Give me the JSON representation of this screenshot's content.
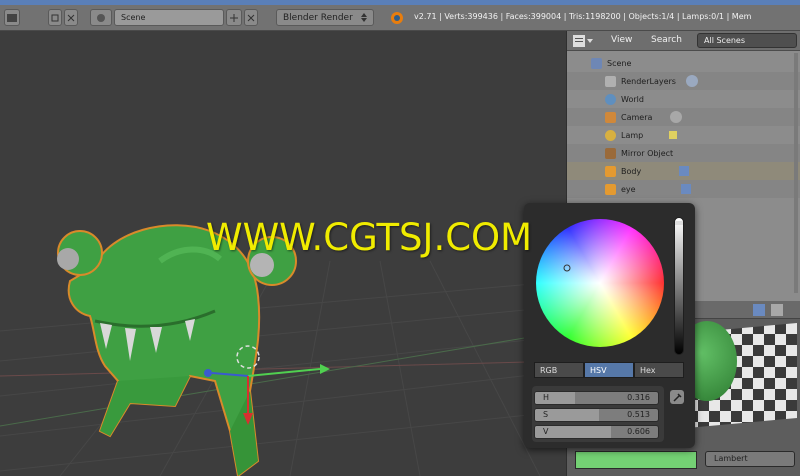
{
  "header": {
    "scene_name": "Scene",
    "render_engine": "Blender Render",
    "stats": "v2.71 | Verts:399436 | Faces:399004 | Tris:1198200 | Objects:1/4 | Lamps:0/1 | Mem"
  },
  "outliner": {
    "view_label": "View",
    "search_label": "Search",
    "filter_value": "All Scenes",
    "items": [
      {
        "label": "Scene"
      },
      {
        "label": "RenderLayers"
      },
      {
        "label": "World"
      },
      {
        "label": "Camera"
      },
      {
        "label": "Lamp"
      },
      {
        "label": "Mirror Object"
      },
      {
        "label": "Body"
      },
      {
        "label": "eye"
      }
    ]
  },
  "color_picker": {
    "modes": [
      "RGB",
      "HSV",
      "Hex"
    ],
    "active_mode": "HSV",
    "h": {
      "label": "H",
      "value": "0.316"
    },
    "s": {
      "label": "S",
      "value": "0.513"
    },
    "v": {
      "label": "V",
      "value": "0.606"
    }
  },
  "material": {
    "shader": "Lambert"
  },
  "watermark": "WWW.CGTSJ.COM",
  "colors": {
    "accent": "#5678a8",
    "object_green": "#3fa043",
    "watermark": "#f0ec00"
  }
}
